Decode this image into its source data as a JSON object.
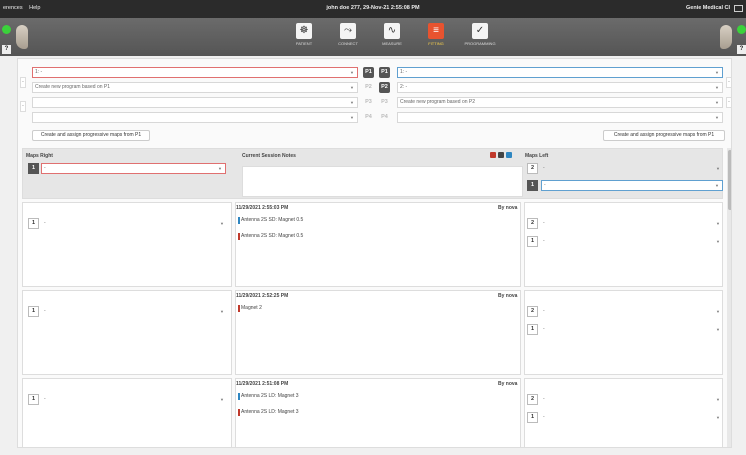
{
  "titlebar": {
    "menu": [
      "erences",
      "Help"
    ],
    "patient": "john doe 277, 29-Nov-21 2:55:08 PM",
    "brand": "Genie Medical CI"
  },
  "toolbar": {
    "tabs": [
      {
        "label": "PATIENT",
        "icon": "patient-icon",
        "glyph": "☸"
      },
      {
        "label": "CONNECT",
        "icon": "connect-icon",
        "glyph": "⤳"
      },
      {
        "label": "MEASURE",
        "icon": "measure-icon",
        "glyph": "∿"
      },
      {
        "label": "FITTING",
        "icon": "fitting-icon",
        "glyph": "≡",
        "active": true
      },
      {
        "label": "PROGRAMMING",
        "icon": "programming-icon",
        "glyph": "✓"
      }
    ],
    "ear_badge": "?"
  },
  "programs": {
    "left": [
      "1: -",
      "Create new program based on P1",
      "",
      ""
    ],
    "right": [
      "1: -",
      "2: -",
      "Create new program based on P2",
      ""
    ],
    "pl": [
      "P1",
      "P2",
      "P3",
      "P4"
    ],
    "pr": [
      "P1",
      "P2",
      "P3",
      "P4"
    ],
    "assign_right": "Create and assign progressive maps from P1",
    "assign_left": "Create and assign progressive maps from P1",
    "side_marker": "-"
  },
  "maps_header": {
    "right_label": "Maps Right",
    "notes_label": "Current Session Notes",
    "left_label": "Maps Left",
    "right_value": "-",
    "left_values": [
      "-",
      "-"
    ],
    "nums_right": [
      "1"
    ],
    "nums_left": [
      "2",
      "1"
    ],
    "colors": [
      "#c0392b",
      "#444444",
      "#2e86c1"
    ]
  },
  "sessions": [
    {
      "timestamp": "11/29/2021 2:55:03 PM",
      "by": "By nova",
      "right_num": "1",
      "right_value": "-",
      "entries": [
        {
          "text": "Antenna 2S SD: Magnet 0.5",
          "color": "#2e86c1"
        },
        {
          "text": "Antenna 2S SD: Magnet 0.5",
          "color": "#c0392b"
        }
      ],
      "left_nums": [
        "2",
        "1"
      ],
      "left_values": [
        "-",
        "-"
      ]
    },
    {
      "timestamp": "11/29/2021 2:52:25 PM",
      "by": "By nova",
      "right_num": "1",
      "right_value": "-",
      "entries": [
        {
          "text": "Magnet 2",
          "color": "#c0392b"
        }
      ],
      "left_nums": [
        "2",
        "1"
      ],
      "left_values": [
        "-",
        "-"
      ]
    },
    {
      "timestamp": "11/29/2021 2:51:08 PM",
      "by": "By nova",
      "right_num": "1",
      "right_value": "-",
      "entries": [
        {
          "text": "Antenna 2S LD: Magnet 3",
          "color": "#2e86c1"
        },
        {
          "text": "Antenna 2S LD: Magnet 3",
          "color": "#c0392b"
        }
      ],
      "left_nums": [
        "2",
        "1"
      ],
      "left_values": [
        "-",
        "-"
      ]
    }
  ]
}
